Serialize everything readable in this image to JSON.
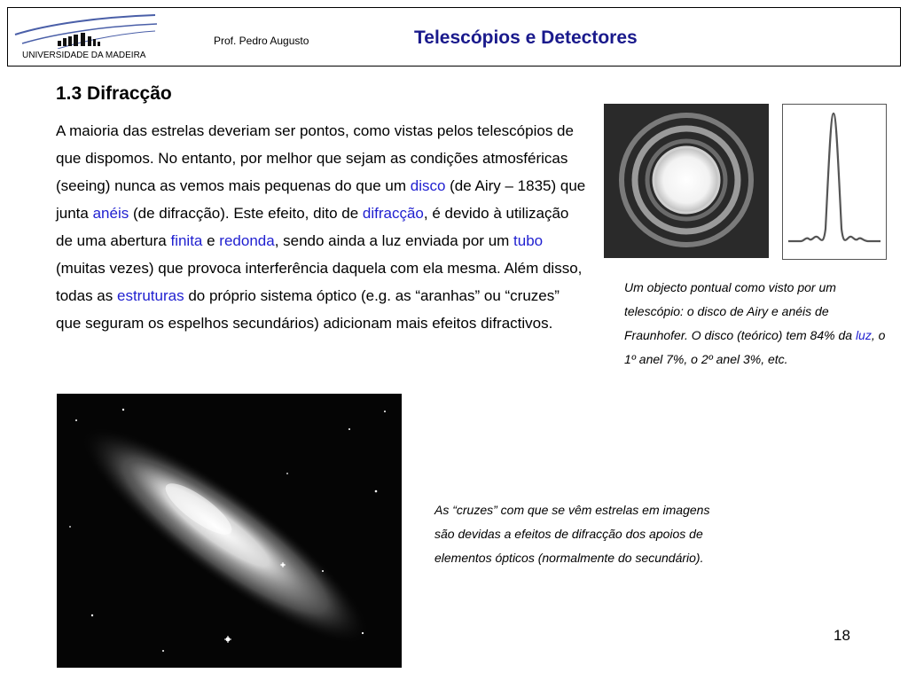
{
  "header": {
    "university": "UNIVERSIDADE DA MADEIRA",
    "author": "Prof. Pedro Augusto",
    "title": "Telescópios e Detectores"
  },
  "section": {
    "heading": "1.3 Difracção"
  },
  "body": {
    "s1": "A maioria das estrelas deveriam ser pontos, como vistas pelos telescópios de que dispomos. No entanto, por melhor que sejam as condições atmosféricas (seeing) nunca as vemos mais pequenas do que um ",
    "k_disco": "disco",
    "s2": " (de Airy – 1835) que junta ",
    "k_aneis": "anéis",
    "s3": " (de difracção). Este efeito, dito de ",
    "k_difraccao": "difracção",
    "s4": ", é devido à utilização de uma abertura ",
    "k_finita": "finita",
    "s5": " e ",
    "k_redonda": "redonda",
    "s6": ", sendo ainda a luz enviada  por um ",
    "k_tubo": "tubo",
    "s7": " (muitas vezes) que provoca interferência daquela com ela mesma. Além disso, todas as ",
    "k_estruturas": "estruturas",
    "s8": " do próprio sistema óptico (e.g. as “aranhas” ou “cruzes” que seguram os espelhos secundários) adicionam mais efeitos difractivos."
  },
  "caption1": {
    "part1": "Um objecto pontual como visto por um telescópio: o disco de Airy e anéis de Fraunhofer. O disco (teórico) tem 84% da ",
    "keyword": "luz",
    "part2": ", o 1º anel 7%, o 2º anel 3%, etc."
  },
  "caption2": {
    "text": "As “cruzes” com que se vêm estrelas em imagens são devidas a efeitos de difracção dos apoios de elementos ópticos (normalmente do secundário)."
  },
  "page_number": "18",
  "colors": {
    "title": "#1a1a8c",
    "keyword": "#1f1fd0",
    "logo_blue": "#4a5fa8"
  }
}
